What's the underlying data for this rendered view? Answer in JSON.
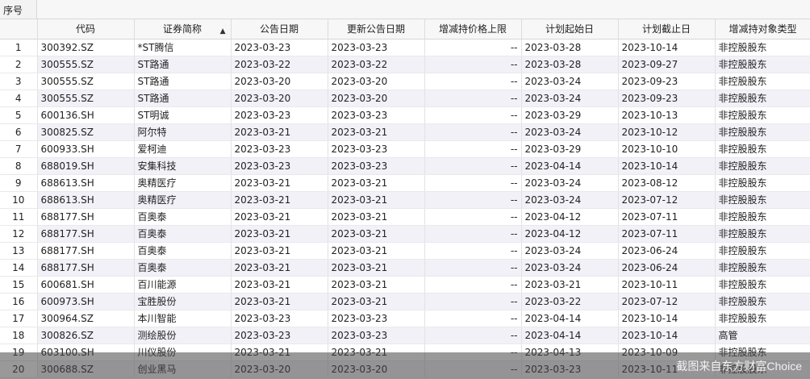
{
  "corner_label": "序号",
  "columns": [
    "代码",
    "证券简称",
    "公告日期",
    "更新公告日期",
    "增减持价格上限",
    "计划起始日",
    "计划截止日",
    "增减持对象类型"
  ],
  "sorted_column_arrow": "▲",
  "rows": [
    {
      "idx": "1",
      "code": "300392.SZ",
      "name": "*ST腾信",
      "ann": "2023-03-23",
      "upd": "2023-03-23",
      "cap": "--",
      "start": "2023-03-28",
      "end": "2023-10-14",
      "type": "非控股股东"
    },
    {
      "idx": "2",
      "code": "300555.SZ",
      "name": "ST路通",
      "ann": "2023-03-22",
      "upd": "2023-03-22",
      "cap": "--",
      "start": "2023-03-28",
      "end": "2023-09-27",
      "type": "非控股股东"
    },
    {
      "idx": "3",
      "code": "300555.SZ",
      "name": "ST路通",
      "ann": "2023-03-20",
      "upd": "2023-03-20",
      "cap": "--",
      "start": "2023-03-24",
      "end": "2023-09-23",
      "type": "非控股股东"
    },
    {
      "idx": "4",
      "code": "300555.SZ",
      "name": "ST路通",
      "ann": "2023-03-20",
      "upd": "2023-03-20",
      "cap": "--",
      "start": "2023-03-24",
      "end": "2023-09-23",
      "type": "非控股股东"
    },
    {
      "idx": "5",
      "code": "600136.SH",
      "name": "ST明诚",
      "ann": "2023-03-23",
      "upd": "2023-03-23",
      "cap": "--",
      "start": "2023-03-29",
      "end": "2023-10-13",
      "type": "非控股股东"
    },
    {
      "idx": "6",
      "code": "300825.SZ",
      "name": "阿尔特",
      "ann": "2023-03-21",
      "upd": "2023-03-21",
      "cap": "--",
      "start": "2023-03-24",
      "end": "2023-10-12",
      "type": "非控股股东"
    },
    {
      "idx": "7",
      "code": "600933.SH",
      "name": "爱柯迪",
      "ann": "2023-03-23",
      "upd": "2023-03-23",
      "cap": "--",
      "start": "2023-03-29",
      "end": "2023-10-10",
      "type": "非控股股东"
    },
    {
      "idx": "8",
      "code": "688019.SH",
      "name": "安集科技",
      "ann": "2023-03-23",
      "upd": "2023-03-23",
      "cap": "--",
      "start": "2023-04-14",
      "end": "2023-10-14",
      "type": "非控股股东"
    },
    {
      "idx": "9",
      "code": "688613.SH",
      "name": "奥精医疗",
      "ann": "2023-03-21",
      "upd": "2023-03-21",
      "cap": "--",
      "start": "2023-03-24",
      "end": "2023-08-12",
      "type": "非控股股东"
    },
    {
      "idx": "10",
      "code": "688613.SH",
      "name": "奥精医疗",
      "ann": "2023-03-21",
      "upd": "2023-03-21",
      "cap": "--",
      "start": "2023-03-24",
      "end": "2023-07-12",
      "type": "非控股股东"
    },
    {
      "idx": "11",
      "code": "688177.SH",
      "name": "百奥泰",
      "ann": "2023-03-21",
      "upd": "2023-03-21",
      "cap": "--",
      "start": "2023-04-12",
      "end": "2023-07-11",
      "type": "非控股股东"
    },
    {
      "idx": "12",
      "code": "688177.SH",
      "name": "百奥泰",
      "ann": "2023-03-21",
      "upd": "2023-03-21",
      "cap": "--",
      "start": "2023-04-12",
      "end": "2023-07-11",
      "type": "非控股股东"
    },
    {
      "idx": "13",
      "code": "688177.SH",
      "name": "百奥泰",
      "ann": "2023-03-21",
      "upd": "2023-03-21",
      "cap": "--",
      "start": "2023-03-24",
      "end": "2023-06-24",
      "type": "非控股股东"
    },
    {
      "idx": "14",
      "code": "688177.SH",
      "name": "百奥泰",
      "ann": "2023-03-21",
      "upd": "2023-03-21",
      "cap": "--",
      "start": "2023-03-24",
      "end": "2023-06-24",
      "type": "非控股股东"
    },
    {
      "idx": "15",
      "code": "600681.SH",
      "name": "百川能源",
      "ann": "2023-03-21",
      "upd": "2023-03-21",
      "cap": "--",
      "start": "2023-03-21",
      "end": "2023-10-11",
      "type": "非控股股东"
    },
    {
      "idx": "16",
      "code": "600973.SH",
      "name": "宝胜股份",
      "ann": "2023-03-21",
      "upd": "2023-03-21",
      "cap": "--",
      "start": "2023-03-22",
      "end": "2023-07-12",
      "type": "非控股股东"
    },
    {
      "idx": "17",
      "code": "300964.SZ",
      "name": "本川智能",
      "ann": "2023-03-23",
      "upd": "2023-03-23",
      "cap": "--",
      "start": "2023-04-14",
      "end": "2023-10-14",
      "type": "非控股股东"
    },
    {
      "idx": "18",
      "code": "300826.SZ",
      "name": "测绘股份",
      "ann": "2023-03-23",
      "upd": "2023-03-23",
      "cap": "--",
      "start": "2023-04-14",
      "end": "2023-10-14",
      "type": "高管"
    },
    {
      "idx": "19",
      "code": "603100.SH",
      "name": "川仪股份",
      "ann": "2023-03-21",
      "upd": "2023-03-21",
      "cap": "--",
      "start": "2023-04-13",
      "end": "2023-10-09",
      "type": "非控股股东"
    },
    {
      "idx": "20",
      "code": "300688.SZ",
      "name": "创业黑马",
      "ann": "2023-03-20",
      "upd": "2023-03-20",
      "cap": "--",
      "start": "2023-03-23",
      "end": "2023-10-11",
      "type": "非控股股东"
    }
  ],
  "watermark": "截图来自东方财富Choice"
}
